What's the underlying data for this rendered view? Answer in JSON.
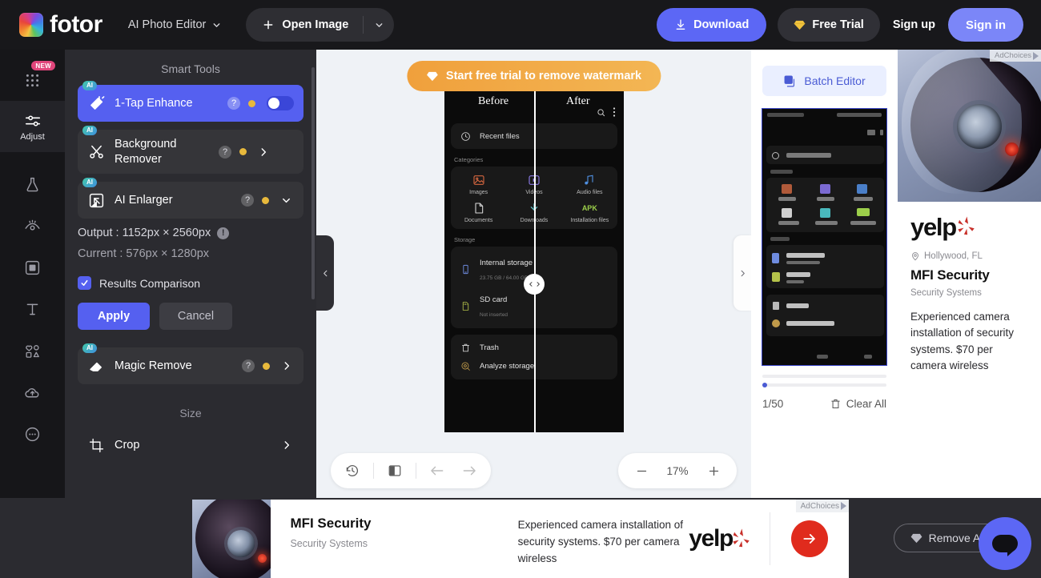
{
  "header": {
    "brand": "fotor",
    "app_selector": "AI Photo Editor",
    "open_image": "Open Image",
    "download": "Download",
    "free_trial": "Free Trial",
    "sign_up": "Sign up",
    "sign_in": "Sign in",
    "accent_blue": "#5c67f5"
  },
  "rail": {
    "new_badge": "NEW",
    "items": [
      {
        "name": "apps-grid-icon",
        "label": ""
      },
      {
        "name": "adjust-icon",
        "label": "Adjust"
      },
      {
        "name": "flask-icon",
        "label": ""
      },
      {
        "name": "retouch-eye-icon",
        "label": ""
      },
      {
        "name": "frame-icon",
        "label": ""
      },
      {
        "name": "text-icon",
        "label": ""
      },
      {
        "name": "elements-icon",
        "label": ""
      },
      {
        "name": "cloud-upload-icon",
        "label": ""
      },
      {
        "name": "more-icon",
        "label": ""
      }
    ]
  },
  "panel": {
    "title": "Smart Tools",
    "tools": [
      {
        "label": "1-Tap Enhance",
        "badge": "AI",
        "active": true,
        "control": "toggle"
      },
      {
        "label": "Background Remover",
        "badge": "AI",
        "active": false,
        "control": "arrow"
      },
      {
        "label": "AI Enlarger",
        "badge": "AI",
        "active": false,
        "control": "caret-down"
      }
    ],
    "output": "Output : 1152px × 2560px",
    "current": "Current : 576px × 1280px",
    "results_comparison": "Results Comparison",
    "apply": "Apply",
    "cancel": "Cancel",
    "magic_remove": {
      "label": "Magic Remove",
      "badge": "AI"
    },
    "size_title": "Size",
    "crop": "Crop",
    "active_color": "#5560f0"
  },
  "canvas": {
    "trial_banner": "Start free trial to remove watermark",
    "before_label": "Before",
    "after_label": "After",
    "zoom_level": "17%",
    "phone": {
      "recent_files": "Recent files",
      "categories_label": "Categories",
      "categories": [
        "Images",
        "Videos",
        "Audio files",
        "Documents",
        "Downloads",
        "Installation files"
      ],
      "apk_tag": "APK",
      "storage_label": "Storage",
      "storage_items": [
        {
          "title": "Internal storage",
          "sub": "23.75 GB / 64.00 GB"
        },
        {
          "title": "SD card",
          "sub": "Not inserted"
        }
      ],
      "extra_items": [
        "Trash",
        "Analyze storage"
      ]
    }
  },
  "batch": {
    "button": "Batch Editor",
    "count": "1/50",
    "clear_all": "Clear All"
  },
  "ad_right": {
    "adchoices": "AdChoices",
    "brand": "yelp",
    "location": "Hollywood, FL",
    "name": "MFI Security",
    "category": "Security Systems",
    "description": "Experienced camera installation of security systems. $70 per camera wireless"
  },
  "ad_bottom": {
    "adchoices": "AdChoices",
    "name": "MFI Security",
    "category": "Security Systems",
    "description": "Experienced camera installation of security systems. $70 per camera wireless",
    "brand": "yelp"
  },
  "footer": {
    "remove_ads": "Remove Ads"
  }
}
